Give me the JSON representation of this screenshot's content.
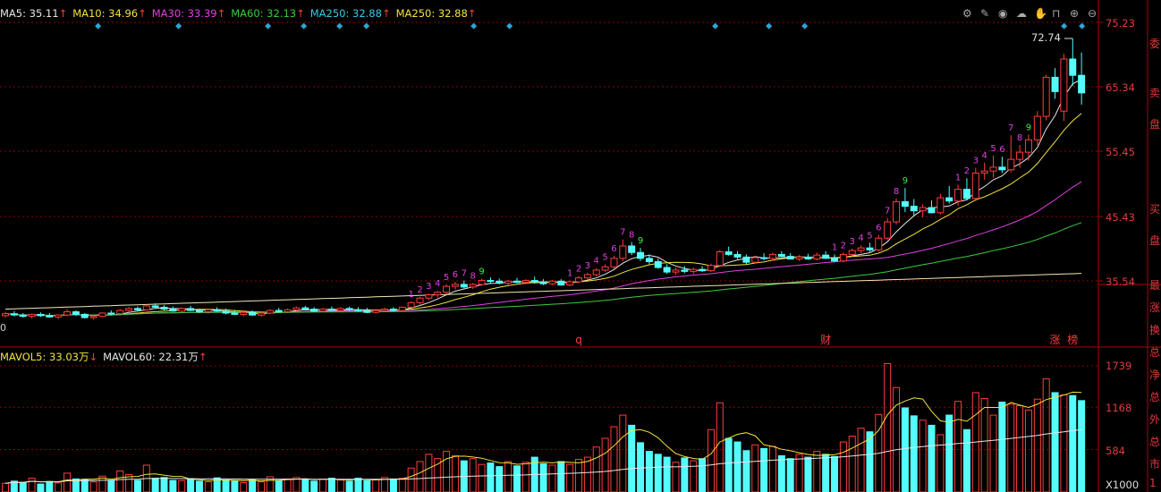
{
  "ma_legend": [
    {
      "label": "MA5: 35.11",
      "arrow": "↑",
      "color": "#e6e6e6"
    },
    {
      "label": "MA10: 34.96",
      "arrow": "↑",
      "color": "#f2e33c"
    },
    {
      "label": "MA30: 33.39",
      "arrow": "↑",
      "color": "#e040e0"
    },
    {
      "label": "MA60: 32.13",
      "arrow": "↑",
      "color": "#3ccc3c"
    },
    {
      "label": "MA250: 32.88",
      "arrow": "↑",
      "color": "#3cc8e6"
    },
    {
      "label": "MA250: 32.88",
      "arrow": "↑",
      "color": "#f2e33c"
    }
  ],
  "vol_legend": [
    {
      "label": "MAVOL5: 33.03万",
      "arrow": "↓",
      "color": "#f2e33c"
    },
    {
      "label": "MAVOL60: 22.31万",
      "arrow": "↑",
      "color": "#e6e6e6"
    }
  ],
  "price_axis": {
    "ticks": [
      "75.23",
      "65.34",
      "55.45",
      "45.43",
      "35.54"
    ],
    "ylim": [
      25.0,
      75.23
    ]
  },
  "volume_axis": {
    "ticks": [
      "1739",
      "1168",
      "584"
    ],
    "unit": "X1000",
    "ylim": [
      0,
      1800
    ]
  },
  "max_price_label": "72.74",
  "left_edge_label": "0",
  "event_markers": [
    {
      "label": "q",
      "at_candle": 65
    },
    {
      "label": "财",
      "at_candle": 93
    },
    {
      "label": "涨",
      "at_candle": 119
    },
    {
      "label": "榜",
      "at_candle": 121
    }
  ],
  "right_side_labels": [
    "委",
    "卖",
    "盘",
    "买",
    "盘",
    "最",
    "涨",
    "换",
    "总",
    "净",
    "总",
    "外",
    "总",
    "市",
    "1"
  ],
  "colors": {
    "up": "#ff3c3c",
    "down": "#54fcfc",
    "grid": "#8b0000",
    "axis_text": "#e03c3c",
    "seq_count": "#e040e0",
    "seq_nine": "#3cf03c"
  },
  "chart_data": {
    "type": "candlestick",
    "series_price": [
      {
        "o": 30.2,
        "h": 30.8,
        "l": 29.9,
        "c": 30.5
      },
      {
        "o": 30.5,
        "h": 30.9,
        "l": 30.1,
        "c": 30.3
      },
      {
        "o": 30.3,
        "h": 30.6,
        "l": 29.9,
        "c": 30.1
      },
      {
        "o": 30.1,
        "h": 30.5,
        "l": 29.8,
        "c": 30.4
      },
      {
        "o": 30.4,
        "h": 30.7,
        "l": 30.0,
        "c": 30.2
      },
      {
        "o": 30.2,
        "h": 30.6,
        "l": 29.9,
        "c": 30.0
      },
      {
        "o": 30.0,
        "h": 30.4,
        "l": 29.7,
        "c": 30.3
      },
      {
        "o": 30.3,
        "h": 31.2,
        "l": 30.1,
        "c": 30.8
      },
      {
        "o": 30.8,
        "h": 31.0,
        "l": 30.2,
        "c": 30.4
      },
      {
        "o": 30.4,
        "h": 30.6,
        "l": 29.8,
        "c": 29.9
      },
      {
        "o": 29.9,
        "h": 30.3,
        "l": 29.6,
        "c": 30.1
      },
      {
        "o": 30.1,
        "h": 30.7,
        "l": 30.0,
        "c": 30.6
      },
      {
        "o": 30.6,
        "h": 31.0,
        "l": 30.3,
        "c": 30.5
      },
      {
        "o": 30.5,
        "h": 31.2,
        "l": 30.4,
        "c": 31.0
      },
      {
        "o": 31.0,
        "h": 31.5,
        "l": 30.7,
        "c": 31.3
      },
      {
        "o": 31.3,
        "h": 31.6,
        "l": 30.9,
        "c": 31.1
      },
      {
        "o": 31.1,
        "h": 31.9,
        "l": 31.0,
        "c": 31.7
      },
      {
        "o": 31.7,
        "h": 32.1,
        "l": 31.3,
        "c": 31.5
      },
      {
        "o": 31.5,
        "h": 31.8,
        "l": 31.0,
        "c": 31.2
      },
      {
        "o": 31.2,
        "h": 31.6,
        "l": 30.8,
        "c": 30.9
      },
      {
        "o": 30.9,
        "h": 31.4,
        "l": 30.7,
        "c": 31.3
      },
      {
        "o": 31.3,
        "h": 31.7,
        "l": 30.9,
        "c": 31.0
      },
      {
        "o": 31.0,
        "h": 31.3,
        "l": 30.6,
        "c": 30.8
      },
      {
        "o": 30.8,
        "h": 31.2,
        "l": 30.5,
        "c": 31.1
      },
      {
        "o": 31.1,
        "h": 31.5,
        "l": 30.8,
        "c": 30.9
      },
      {
        "o": 30.9,
        "h": 31.3,
        "l": 30.4,
        "c": 30.6
      },
      {
        "o": 30.6,
        "h": 31.1,
        "l": 30.3,
        "c": 30.4
      },
      {
        "o": 30.4,
        "h": 30.9,
        "l": 30.1,
        "c": 30.7
      },
      {
        "o": 30.7,
        "h": 31.0,
        "l": 30.2,
        "c": 30.3
      },
      {
        "o": 30.3,
        "h": 30.8,
        "l": 30.0,
        "c": 30.6
      },
      {
        "o": 30.6,
        "h": 31.2,
        "l": 30.4,
        "c": 31.0
      },
      {
        "o": 31.0,
        "h": 31.4,
        "l": 30.7,
        "c": 30.8
      },
      {
        "o": 30.8,
        "h": 31.3,
        "l": 30.6,
        "c": 31.1
      },
      {
        "o": 31.1,
        "h": 31.6,
        "l": 30.9,
        "c": 31.4
      },
      {
        "o": 31.4,
        "h": 31.7,
        "l": 31.0,
        "c": 31.2
      },
      {
        "o": 31.2,
        "h": 31.5,
        "l": 30.8,
        "c": 30.9
      },
      {
        "o": 30.9,
        "h": 31.4,
        "l": 30.7,
        "c": 31.2
      },
      {
        "o": 31.2,
        "h": 31.6,
        "l": 30.9,
        "c": 31.0
      },
      {
        "o": 31.0,
        "h": 31.5,
        "l": 30.8,
        "c": 31.3
      },
      {
        "o": 31.3,
        "h": 31.6,
        "l": 30.9,
        "c": 31.1
      },
      {
        "o": 31.1,
        "h": 31.5,
        "l": 30.8,
        "c": 31.0
      },
      {
        "o": 31.0,
        "h": 31.4,
        "l": 30.6,
        "c": 30.7
      },
      {
        "o": 30.7,
        "h": 31.1,
        "l": 30.5,
        "c": 31.0
      },
      {
        "o": 31.0,
        "h": 31.4,
        "l": 30.8,
        "c": 31.2
      },
      {
        "o": 31.2,
        "h": 31.5,
        "l": 30.9,
        "c": 31.0
      },
      {
        "o": 31.0,
        "h": 31.6,
        "l": 30.9,
        "c": 31.5
      },
      {
        "o": 31.5,
        "h": 32.4,
        "l": 31.3,
        "c": 32.2
      },
      {
        "o": 32.2,
        "h": 33.1,
        "l": 31.9,
        "c": 32.9
      },
      {
        "o": 32.9,
        "h": 33.6,
        "l": 32.6,
        "c": 33.4
      },
      {
        "o": 33.4,
        "h": 34.0,
        "l": 33.0,
        "c": 33.8
      },
      {
        "o": 33.8,
        "h": 35.0,
        "l": 33.5,
        "c": 34.7
      },
      {
        "o": 34.7,
        "h": 35.4,
        "l": 34.2,
        "c": 35.0
      },
      {
        "o": 35.0,
        "h": 35.6,
        "l": 34.4,
        "c": 34.6
      },
      {
        "o": 34.6,
        "h": 35.2,
        "l": 34.3,
        "c": 35.0
      },
      {
        "o": 35.0,
        "h": 35.9,
        "l": 34.8,
        "c": 35.6
      },
      {
        "o": 35.6,
        "h": 36.1,
        "l": 35.2,
        "c": 35.5
      },
      {
        "o": 35.5,
        "h": 35.9,
        "l": 35.0,
        "c": 35.2
      },
      {
        "o": 35.2,
        "h": 35.7,
        "l": 34.9,
        "c": 35.5
      },
      {
        "o": 35.5,
        "h": 36.0,
        "l": 35.2,
        "c": 35.3
      },
      {
        "o": 35.3,
        "h": 35.8,
        "l": 35.0,
        "c": 35.6
      },
      {
        "o": 35.6,
        "h": 36.2,
        "l": 35.1,
        "c": 35.4
      },
      {
        "o": 35.4,
        "h": 35.8,
        "l": 34.9,
        "c": 35.1
      },
      {
        "o": 35.1,
        "h": 35.7,
        "l": 34.9,
        "c": 35.5
      },
      {
        "o": 35.5,
        "h": 35.8,
        "l": 34.8,
        "c": 34.9
      },
      {
        "o": 34.9,
        "h": 35.6,
        "l": 34.7,
        "c": 35.4
      },
      {
        "o": 35.4,
        "h": 36.3,
        "l": 35.2,
        "c": 36.0
      },
      {
        "o": 36.0,
        "h": 36.8,
        "l": 35.7,
        "c": 36.5
      },
      {
        "o": 36.5,
        "h": 37.5,
        "l": 36.2,
        "c": 37.2
      },
      {
        "o": 37.2,
        "h": 38.1,
        "l": 36.9,
        "c": 37.7
      },
      {
        "o": 37.7,
        "h": 39.4,
        "l": 37.4,
        "c": 39.0
      },
      {
        "o": 39.0,
        "h": 41.9,
        "l": 38.6,
        "c": 40.9
      },
      {
        "o": 40.9,
        "h": 41.5,
        "l": 39.5,
        "c": 39.9
      },
      {
        "o": 39.9,
        "h": 40.6,
        "l": 38.6,
        "c": 39.0
      },
      {
        "o": 39.0,
        "h": 39.6,
        "l": 38.1,
        "c": 38.5
      },
      {
        "o": 38.5,
        "h": 39.0,
        "l": 37.4,
        "c": 37.6
      },
      {
        "o": 37.6,
        "h": 38.1,
        "l": 36.6,
        "c": 36.9
      },
      {
        "o": 36.9,
        "h": 37.6,
        "l": 36.5,
        "c": 37.2
      },
      {
        "o": 37.2,
        "h": 37.8,
        "l": 36.7,
        "c": 37.0
      },
      {
        "o": 37.0,
        "h": 37.6,
        "l": 36.6,
        "c": 37.3
      },
      {
        "o": 37.3,
        "h": 37.8,
        "l": 36.9,
        "c": 37.1
      },
      {
        "o": 37.1,
        "h": 38.2,
        "l": 36.9,
        "c": 37.9
      },
      {
        "o": 37.9,
        "h": 40.3,
        "l": 37.7,
        "c": 40.0
      },
      {
        "o": 40.0,
        "h": 40.8,
        "l": 39.4,
        "c": 39.6
      },
      {
        "o": 39.6,
        "h": 40.1,
        "l": 38.9,
        "c": 39.2
      },
      {
        "o": 39.2,
        "h": 39.6,
        "l": 38.1,
        "c": 38.4
      },
      {
        "o": 38.4,
        "h": 39.4,
        "l": 38.2,
        "c": 39.1
      },
      {
        "o": 39.1,
        "h": 39.8,
        "l": 38.7,
        "c": 39.0
      },
      {
        "o": 39.0,
        "h": 39.9,
        "l": 38.6,
        "c": 39.6
      },
      {
        "o": 39.6,
        "h": 40.1,
        "l": 39.2,
        "c": 39.3
      },
      {
        "o": 39.3,
        "h": 39.8,
        "l": 38.8,
        "c": 38.9
      },
      {
        "o": 38.9,
        "h": 39.5,
        "l": 38.6,
        "c": 39.2
      },
      {
        "o": 39.2,
        "h": 39.7,
        "l": 38.8,
        "c": 38.9
      },
      {
        "o": 38.9,
        "h": 39.9,
        "l": 38.7,
        "c": 39.5
      },
      {
        "o": 39.5,
        "h": 40.1,
        "l": 38.9,
        "c": 39.0
      },
      {
        "o": 39.0,
        "h": 39.6,
        "l": 38.4,
        "c": 38.6
      },
      {
        "o": 38.6,
        "h": 39.9,
        "l": 38.4,
        "c": 39.6
      },
      {
        "o": 39.6,
        "h": 40.5,
        "l": 39.3,
        "c": 40.2
      },
      {
        "o": 40.2,
        "h": 41.0,
        "l": 39.8,
        "c": 40.6
      },
      {
        "o": 40.6,
        "h": 41.4,
        "l": 40.0,
        "c": 40.3
      },
      {
        "o": 40.3,
        "h": 42.6,
        "l": 40.1,
        "c": 42.1
      },
      {
        "o": 42.1,
        "h": 45.2,
        "l": 41.8,
        "c": 44.6
      },
      {
        "o": 44.6,
        "h": 48.2,
        "l": 44.2,
        "c": 47.7
      },
      {
        "o": 47.7,
        "h": 49.8,
        "l": 46.1,
        "c": 47.0
      },
      {
        "o": 47.0,
        "h": 48.1,
        "l": 45.6,
        "c": 46.3
      },
      {
        "o": 46.3,
        "h": 47.3,
        "l": 45.3,
        "c": 46.8
      },
      {
        "o": 46.8,
        "h": 47.9,
        "l": 45.9,
        "c": 46.0
      },
      {
        "o": 46.0,
        "h": 48.9,
        "l": 45.7,
        "c": 48.3
      },
      {
        "o": 48.3,
        "h": 50.1,
        "l": 47.4,
        "c": 47.8
      },
      {
        "o": 47.8,
        "h": 50.3,
        "l": 47.1,
        "c": 49.6
      },
      {
        "o": 49.6,
        "h": 51.3,
        "l": 47.9,
        "c": 48.2
      },
      {
        "o": 48.2,
        "h": 52.9,
        "l": 47.8,
        "c": 52.1
      },
      {
        "o": 52.1,
        "h": 53.7,
        "l": 51.1,
        "c": 52.4
      },
      {
        "o": 52.4,
        "h": 54.8,
        "l": 51.4,
        "c": 53.0
      },
      {
        "o": 53.0,
        "h": 54.6,
        "l": 52.1,
        "c": 52.6
      },
      {
        "o": 52.6,
        "h": 57.9,
        "l": 52.2,
        "c": 54.2
      },
      {
        "o": 54.2,
        "h": 56.4,
        "l": 52.9,
        "c": 55.3
      },
      {
        "o": 55.3,
        "h": 58.0,
        "l": 54.0,
        "c": 57.2
      },
      {
        "o": 57.2,
        "h": 61.6,
        "l": 56.4,
        "c": 60.8
      },
      {
        "o": 60.8,
        "h": 67.2,
        "l": 60.2,
        "c": 66.8
      },
      {
        "o": 66.8,
        "h": 68.2,
        "l": 63.5,
        "c": 64.6
      },
      {
        "o": 61.6,
        "h": 70.4,
        "l": 60.1,
        "c": 69.6
      },
      {
        "o": 69.6,
        "h": 72.74,
        "l": 65.5,
        "c": 67.1
      },
      {
        "o": 67.1,
        "h": 70.6,
        "l": 62.6,
        "c": 64.4
      }
    ],
    "series_volume": [
      120,
      150,
      130,
      190,
      110,
      145,
      125,
      260,
      180,
      175,
      140,
      220,
      160,
      290,
      240,
      160,
      370,
      190,
      200,
      160,
      155,
      185,
      150,
      140,
      195,
      165,
      150,
      130,
      170,
      140,
      210,
      160,
      180,
      200,
      170,
      150,
      175,
      190,
      165,
      150,
      190,
      155,
      170,
      200,
      180,
      190,
      330,
      420,
      520,
      460,
      560,
      500,
      430,
      460,
      380,
      400,
      350,
      420,
      360,
      410,
      480,
      390,
      370,
      420,
      380,
      450,
      480,
      620,
      740,
      900,
      1060,
      920,
      680,
      560,
      520,
      480,
      410,
      470,
      430,
      460,
      860,
      1230,
      740,
      690,
      570,
      650,
      600,
      630,
      500,
      460,
      520,
      480,
      560,
      520,
      490,
      690,
      770,
      880,
      830,
      1070,
      1770,
      1440,
      1160,
      1050,
      990,
      920,
      790,
      1060,
      1250,
      860,
      1370,
      1290,
      1060,
      1240,
      1210,
      1190,
      1130,
      1280,
      1560,
      1370,
      1340,
      1330,
      1260
    ]
  }
}
